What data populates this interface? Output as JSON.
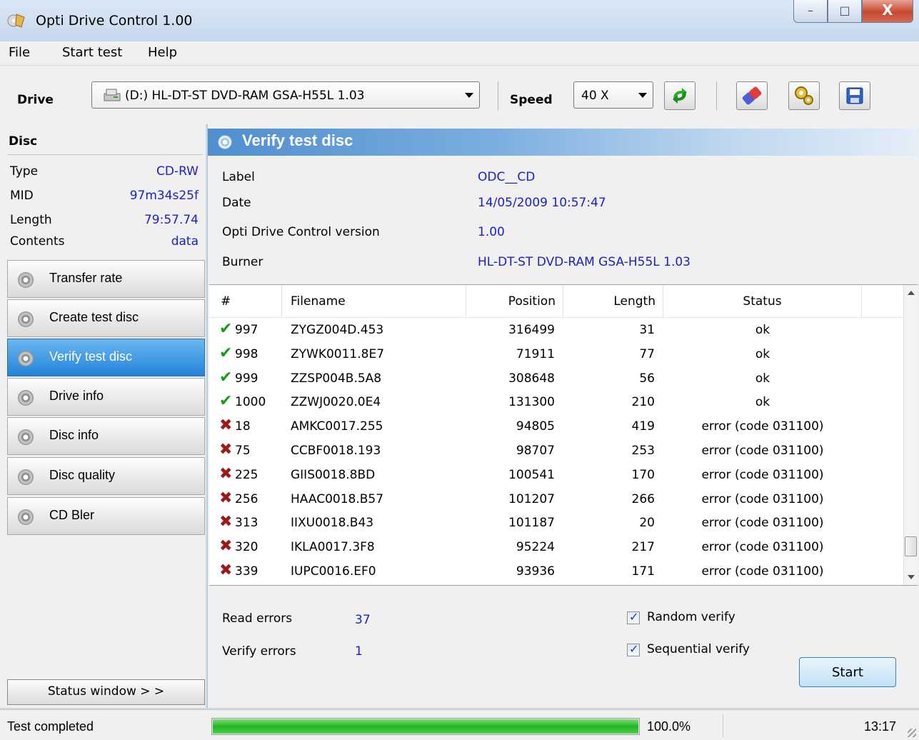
{
  "window": {
    "title": "Opti Drive Control 1.00",
    "minimize": "–",
    "maximize": "□",
    "close": "X"
  },
  "menu": {
    "file": "File",
    "start_test": "Start test",
    "help": "Help"
  },
  "toolbar": {
    "drive_label": "Drive",
    "drive_value": "(D:)  HL-DT-ST DVD-RAM GSA-H55L 1.03",
    "speed_label": "Speed",
    "speed_value": "40 X"
  },
  "disc": {
    "heading": "Disc",
    "rows": [
      {
        "key": "Type",
        "value": "CD-RW"
      },
      {
        "key": "MID",
        "value": "97m34s25f"
      },
      {
        "key": "Length",
        "value": "79:57.74"
      },
      {
        "key": "Contents",
        "value": "data"
      }
    ]
  },
  "nav": [
    {
      "label": "Transfer rate"
    },
    {
      "label": "Create test disc"
    },
    {
      "label": "Verify test disc"
    },
    {
      "label": "Drive info"
    },
    {
      "label": "Disc info"
    },
    {
      "label": "Disc quality"
    },
    {
      "label": "CD Bler"
    }
  ],
  "status_window_button": "Status window > >",
  "panel": {
    "title": "Verify test disc",
    "info": [
      {
        "key": "Label",
        "value": "ODC__CD"
      },
      {
        "key": "Date",
        "value": "14/05/2009 10:57:47"
      },
      {
        "key": "Opti Drive Control version",
        "value": "1.00"
      },
      {
        "key": "Burner",
        "value": "HL-DT-ST DVD-RAM GSA-H55L 1.03"
      }
    ]
  },
  "table": {
    "headers": [
      "#",
      "Filename",
      "Position",
      "Length",
      "Status"
    ],
    "rows": [
      {
        "ok": true,
        "num": "997",
        "file": "ZYGZ004D.453",
        "pos": "316499",
        "len": "31",
        "status": "ok"
      },
      {
        "ok": true,
        "num": "998",
        "file": "ZYWK0011.8E7",
        "pos": "71911",
        "len": "77",
        "status": "ok"
      },
      {
        "ok": true,
        "num": "999",
        "file": "ZZSP004B.5A8",
        "pos": "308648",
        "len": "56",
        "status": "ok"
      },
      {
        "ok": true,
        "num": "1000",
        "file": "ZZWJ0020.0E4",
        "pos": "131300",
        "len": "210",
        "status": "ok"
      },
      {
        "ok": false,
        "num": "18",
        "file": "AMKC0017.255",
        "pos": "94805",
        "len": "419",
        "status": "error (code 031100)"
      },
      {
        "ok": false,
        "num": "75",
        "file": "CCBF0018.193",
        "pos": "98707",
        "len": "253",
        "status": "error (code 031100)"
      },
      {
        "ok": false,
        "num": "225",
        "file": "GIIS0018.8BD",
        "pos": "100541",
        "len": "170",
        "status": "error (code 031100)"
      },
      {
        "ok": false,
        "num": "256",
        "file": "HAAC0018.B57",
        "pos": "101207",
        "len": "266",
        "status": "error (code 031100)"
      },
      {
        "ok": false,
        "num": "313",
        "file": "IIXU0018.B43",
        "pos": "101187",
        "len": "20",
        "status": "error (code 031100)"
      },
      {
        "ok": false,
        "num": "320",
        "file": "IKLA0017.3F8",
        "pos": "95224",
        "len": "217",
        "status": "error (code 031100)"
      },
      {
        "ok": false,
        "num": "339",
        "file": "IUPC0016.EF0",
        "pos": "93936",
        "len": "171",
        "status": "error (code 031100)"
      }
    ]
  },
  "results": {
    "read_errors_label": "Read errors",
    "read_errors_value": "37",
    "verify_errors_label": "Verify errors",
    "verify_errors_value": "1",
    "random_verify_label": "Random verify",
    "sequential_verify_label": "Sequential verify",
    "start_label": "Start"
  },
  "statusbar": {
    "text": "Test completed",
    "progress_percent": 100,
    "percent_text": "100.0%",
    "time": "13:17"
  },
  "colors": {
    "value_blue": "#1b21c9",
    "accent": "#2283d8",
    "ok_green": "#1a9a1a",
    "error_red": "#a01717"
  }
}
